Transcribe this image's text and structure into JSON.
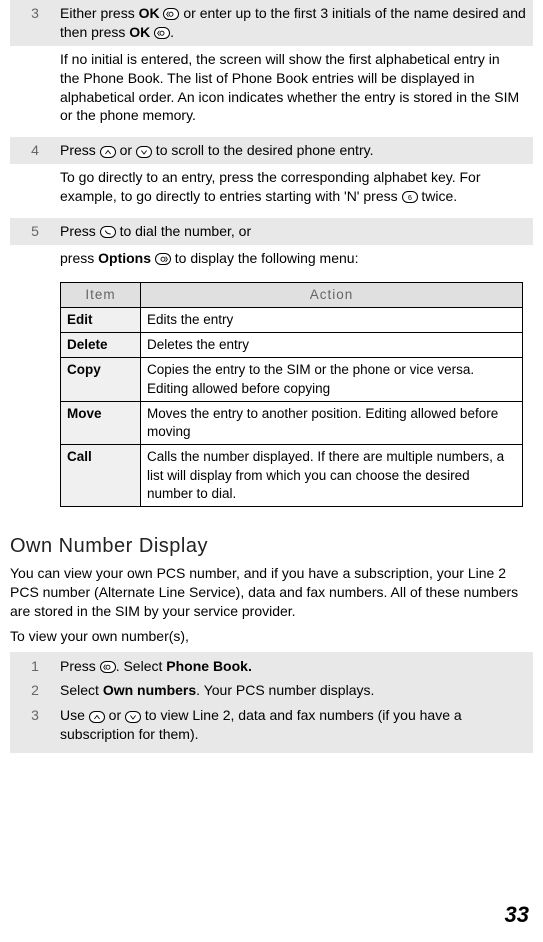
{
  "steps": {
    "s3": {
      "num": "3",
      "line_a": "Either press ",
      "ok1": "OK",
      "line_b": " or enter up to the first 3 initials of the name desired and then press ",
      "ok2": "OK",
      "line_c": ".",
      "para": "If no initial is entered, the screen will show the first alphabetical entry in the Phone Book. The list of Phone Book entries will be displayed in alphabetical order. An icon indicates whether the entry is stored in the SIM or the phone memory."
    },
    "s4": {
      "num": "4",
      "line_a": "Press ",
      "line_b": " or ",
      "line_c": " to scroll to the desired phone entry.",
      "para_a": "To go directly to an entry, press the corresponding alphabet key. For example, to go directly to entries starting with 'N' press ",
      "para_b": " twice."
    },
    "s5": {
      "num": "5",
      "line_a": "Press ",
      "line_b": " to dial the number, or",
      "options_a": "press  ",
      "options_bold": "Options",
      "options_b": " to display the following menu:"
    }
  },
  "table": {
    "headers": {
      "item": "Item",
      "action": "Action"
    },
    "rows": [
      {
        "item": "Edit",
        "action": "Edits the entry"
      },
      {
        "item": "Delete",
        "action": "Deletes the entry"
      },
      {
        "item": "Copy",
        "action": "Copies the entry to the SIM or the phone or vice versa. Editing allowed before copying"
      },
      {
        "item": "Move",
        "action": "Moves the entry to another position. Editing allowed before moving"
      },
      {
        "item": "Call",
        "action": "Calls the number displayed. If there are multiple numbers, a list will display from which you can choose the desired number to dial."
      }
    ]
  },
  "own": {
    "heading": "Own Number Display",
    "body": "You can view your own PCS number, and if you have a subscription, your Line 2 PCS number (Alternate Line Service), data and fax numbers. All of these numbers are stored in the SIM by your service provider.",
    "prompt": "To view your own number(s),",
    "rows": {
      "r1": {
        "num": "1",
        "a": "Press ",
        "b": ". Select ",
        "bold": "Phone Book."
      },
      "r2": {
        "num": "2",
        "a": "Select ",
        "bold": "Own numbers",
        "b": ". Your PCS number displays."
      },
      "r3": {
        "num": "3",
        "a": "Use ",
        "b": " or ",
        "c": " to view Line 2, data and fax numbers (if you have a subscription for them)."
      }
    }
  },
  "page_number": "33"
}
